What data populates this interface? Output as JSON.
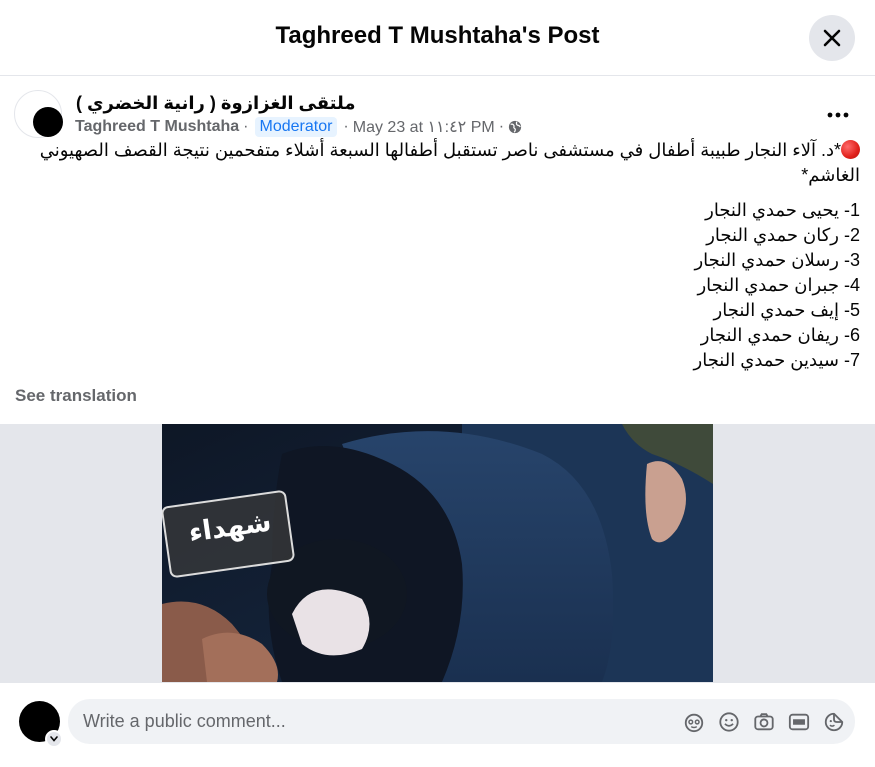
{
  "dialog": {
    "title": "Taghreed T Mushtaha's Post"
  },
  "post": {
    "group_name": "ملتقى الغزازوة ( رانية الخضري )",
    "author": "Taghreed T Mushtaha",
    "role_badge": "Moderator",
    "timestamp": "May 23 at ١١:٤٢ PM",
    "separator": "·",
    "intro_text": "*د. آلاء النجار طبيبة أطفال في مستشفى ناصر تستقبل أطفالها السبعة أشلاء متفحمين نتيجة القصف الصهيوني الغاشم*",
    "list": [
      "1- يحيى حمدي النجار",
      "2- ركان حمدي النجار",
      "3- رسلان حمدي النجار",
      "4- جبران حمدي النجار",
      "5- إيف حمدي النجار",
      "6- ريفان حمدي النجار",
      "7- سيدين حمدي النجار"
    ],
    "see_translation": "See translation",
    "photo_watermark": "شهداء"
  },
  "composer": {
    "placeholder": "Write a public comment..."
  },
  "icons": {
    "close": "close-icon",
    "more": "more-options-icon",
    "privacy": "globe-icon",
    "avatar_menu": "chevron-down-icon",
    "composer": [
      "avatar-frame-icon",
      "emoji-icon",
      "camera-icon",
      "gif-icon",
      "sticker-icon"
    ]
  }
}
